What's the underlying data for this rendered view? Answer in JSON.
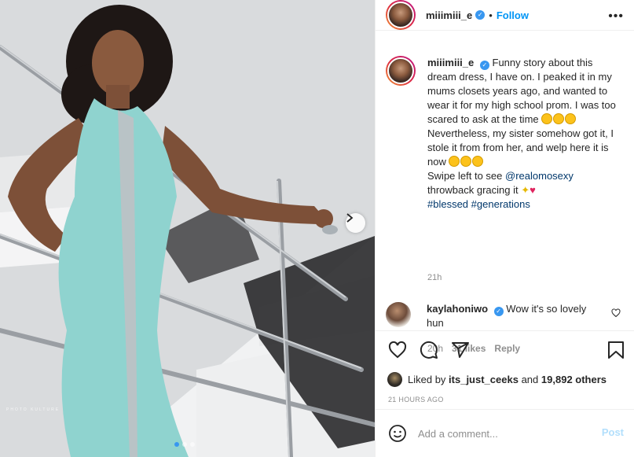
{
  "post": {
    "username": "miiimiii_e",
    "follow_label": "Follow",
    "more_label": "•••",
    "caption_parts": {
      "line1": "Funny story about this dream dress, I have on. I peaked it in my mums closets years ago, and wanted to wear it for my high school prom. I was too scared to ask at the time",
      "line2": "Nevertheless, my sister somehow got it, I stole it from from her, and welp here it is now",
      "line3_pre": "Swipe left to see",
      "mention": "@realomosexy",
      "line4": "throwback gracing it",
      "hashtag1": "#blessed",
      "hashtag2": "#generations"
    },
    "caption_time": "21h",
    "photo_watermark": "PHOTO KULTURE",
    "carousel": {
      "count": 3,
      "active_index": 0
    }
  },
  "comment": {
    "username": "kaylahoniwo",
    "text": "Wow it's so lovely hun",
    "time": "20h",
    "likes": "31 likes",
    "reply_label": "Reply"
  },
  "likes_bar": {
    "prefix": "Liked by",
    "liker": "its_just_ceeks",
    "connector": "and",
    "others": "19,892 others"
  },
  "timestamp": "21 HOURS AGO",
  "add_comment": {
    "placeholder": "Add a comment...",
    "post_label": "Post"
  },
  "icons": [
    "heart-icon",
    "comment-icon",
    "share-icon",
    "bookmark-icon",
    "smile-icon",
    "chevron-right-icon",
    "more-icon",
    "verified-icon"
  ],
  "colors": {
    "accent": "#0095f6",
    "post_disabled": "#b2dffc",
    "dress": "#8fd3cf",
    "heart": "#e0245e"
  }
}
